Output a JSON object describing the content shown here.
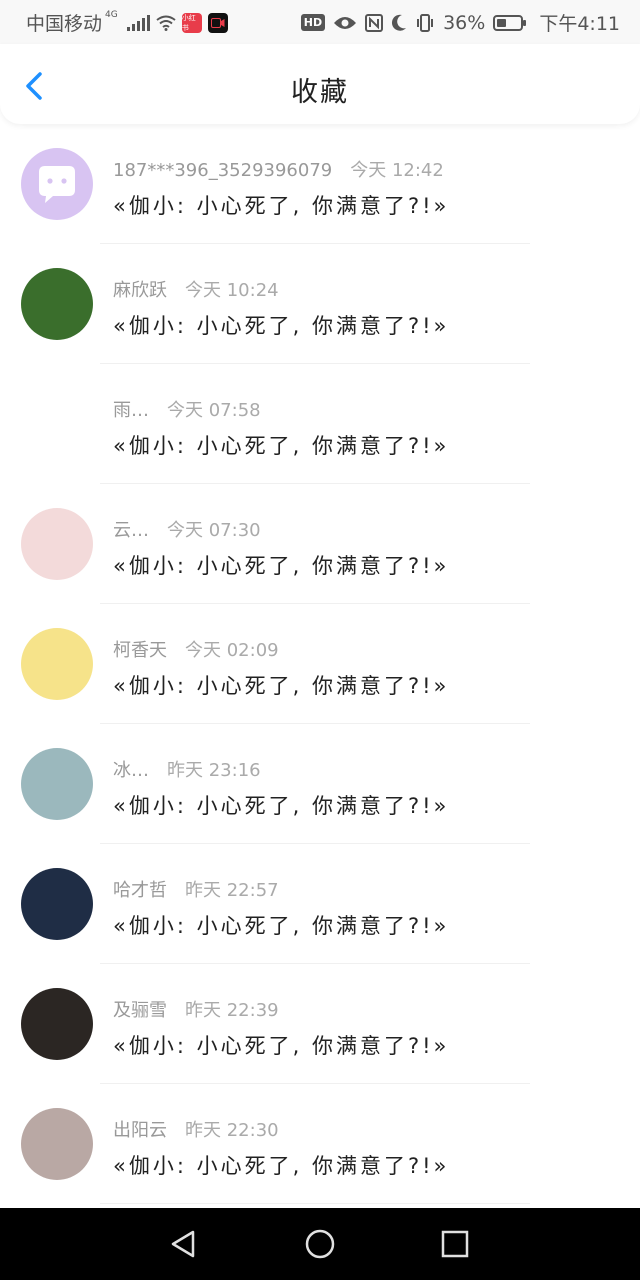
{
  "status_bar": {
    "carrier": "中国移动",
    "network": "4G",
    "app_badge_1": "小红书",
    "hd": "HD",
    "battery_percent": "36%",
    "battery_level": 0.36,
    "time": "下午4:11"
  },
  "header": {
    "title": "收藏"
  },
  "favorites": [
    {
      "name": "187***396_3529396079",
      "time": "今天 12:42",
      "message": "«伽小: 小心死了, 你满意了?!»",
      "avatar_color": "#d8c4f2"
    },
    {
      "name": "麻欣跃",
      "time": "今天 10:24",
      "message": "«伽小: 小心死了, 你满意了?!»",
      "avatar_color": "#3a6e2c"
    },
    {
      "name": "雨…",
      "time": "今天 07:58",
      "message": "«伽小: 小心死了, 你满意了?!»",
      "avatar_color": "#ffffff"
    },
    {
      "name": "云…",
      "time": "今天 07:30",
      "message": "«伽小: 小心死了, 你满意了?!»",
      "avatar_color": "#f3dada"
    },
    {
      "name": "柯香天",
      "time": "今天 02:09",
      "message": "«伽小: 小心死了, 你满意了?!»",
      "avatar_color": "#f6e38a"
    },
    {
      "name": "冰…",
      "time": "昨天 23:16",
      "message": "«伽小: 小心死了, 你满意了?!»",
      "avatar_color": "#9bb8bd"
    },
    {
      "name": "哈才哲",
      "time": "昨天 22:57",
      "message": "«伽小: 小心死了, 你满意了?!»",
      "avatar_color": "#1f2d45"
    },
    {
      "name": "及骊雪",
      "time": "昨天 22:39",
      "message": "«伽小: 小心死了, 你满意了?!»",
      "avatar_color": "#2b2623"
    },
    {
      "name": "出阳云",
      "time": "昨天 22:30",
      "message": "«伽小: 小心死了, 你满意了?!»",
      "avatar_color": "#b9a8a4"
    }
  ],
  "icons": {
    "back": "chevron-left-icon",
    "nav_back": "triangle-back-icon",
    "nav_home": "circle-home-icon",
    "nav_recent": "square-recent-icon"
  },
  "colors": {
    "accent": "#1e90ff",
    "nav_bar": "#000000"
  }
}
